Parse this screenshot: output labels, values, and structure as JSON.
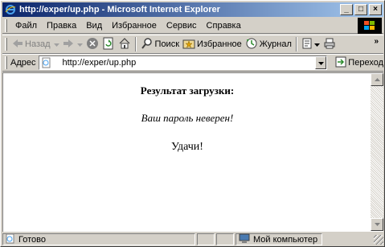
{
  "window": {
    "title": "http://exper/up.php - Microsoft Internet Explorer",
    "min_symbol": "_",
    "max_symbol": "□",
    "close_symbol": "×"
  },
  "menubar": {
    "items": [
      "Файл",
      "Правка",
      "Вид",
      "Избранное",
      "Сервис",
      "Справка"
    ]
  },
  "toolbar": {
    "back_label": "Назад",
    "search_label": "Поиск",
    "favorites_label": "Избранное",
    "journal_label": "Журнал",
    "more_symbol": "»"
  },
  "addressbar": {
    "label": "Адрес",
    "url": "http://exper/up.php",
    "go_label": "Переход"
  },
  "page": {
    "heading": "Результат загрузки:",
    "message": "Ваш пароль неверен!",
    "luck": "Удачи!"
  },
  "statusbar": {
    "status": "Готово",
    "zone": "Мой компьютер"
  },
  "colors": {
    "title_start": "#0a246a",
    "title_end": "#a6caf0",
    "chrome": "#d4d0c8"
  }
}
